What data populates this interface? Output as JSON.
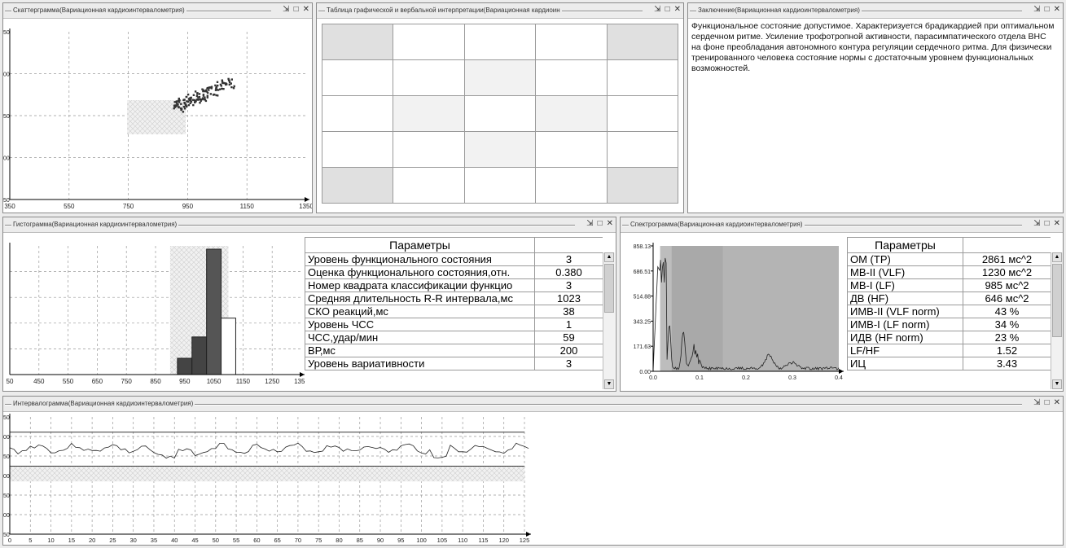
{
  "panels": {
    "scatter": {
      "title": "Скаттерграмма(Вариационная кардиоинтервалометрия)"
    },
    "interp": {
      "title": "Таблица графической и вербальной интерпретации(Вариационная кардиоин"
    },
    "conclusion": {
      "title": "Заключение(Вариационная кардиоинтервалометрия)",
      "text": "Функциональное состояние допустимое. Характеризуется брадикардией при оптимальном сердечном ритме. Усиление трофотропной активности, парасимпатического отдела ВНС на фоне преобладания автономного контура регуляции сердечного ритма. Для физически тренированного человека состояние нормы с достаточным уровнем функциональных возможностей."
    },
    "histogram": {
      "title": "Гистограмма(Вариационная кардиоинтервалометрия)"
    },
    "spectrum": {
      "title": "Спектрограмма(Вариационная кардиоинтервалометрия)"
    },
    "interval": {
      "title": "Интервалограмма(Вариационная кардиоинтервалометрия)"
    }
  },
  "window_buttons": {
    "pin": "⇲",
    "restore": "□",
    "close": "✕"
  },
  "hist_params": {
    "header": "Параметры",
    "rows": [
      {
        "label": "Уровень функционального состояния",
        "value": "3"
      },
      {
        "label": "Оценка функционального состояния,отн.",
        "value": "0.380"
      },
      {
        "label": " Номер квадрата классификации функцио",
        "value": "3"
      },
      {
        "label": "Средняя длительность R-R интервала,мс",
        "value": "1023"
      },
      {
        "label": "СКО реакций,мс",
        "value": "38"
      },
      {
        "label": "Уровень ЧСС",
        "value": "1"
      },
      {
        "label": "ЧСС,удар/мин",
        "value": "59"
      },
      {
        "label": "ВР,мс",
        "value": "200"
      },
      {
        "label": "Уровень вариативности",
        "value": "3"
      }
    ]
  },
  "spec_params": {
    "header": "Параметры",
    "rows": [
      {
        "label": "ОМ (ТР)",
        "value": "2861 мс^2"
      },
      {
        "label": "МВ-II (VLF)",
        "value": "1230 мс^2"
      },
      {
        "label": "МВ-I (LF)",
        "value": "985 мс^2"
      },
      {
        "label": "ДВ (HF)",
        "value": "646 мс^2"
      },
      {
        "label": "ИМВ-II (VLF norm)",
        "value": "43 %"
      },
      {
        "label": "ИМВ-I (LF norm)",
        "value": "34 %"
      },
      {
        "label": "ИДВ (HF norm)",
        "value": "23 %"
      },
      {
        "label": "LF/HF",
        "value": "1.52"
      },
      {
        "label": "ИЦ",
        "value": "3.43"
      }
    ]
  },
  "chart_data": [
    {
      "type": "scatter",
      "x_ticks": [
        "350",
        "550",
        "750",
        "950",
        "1150",
        "1350"
      ],
      "y_ticks": [
        "50",
        "00",
        "50",
        "00",
        "50"
      ],
      "xlim": [
        350,
        1350
      ],
      "points_center": [
        1020,
        1020
      ]
    },
    {
      "type": "bar",
      "x_ticks": [
        "50",
        "450",
        "550",
        "650",
        "750",
        "850",
        "950",
        "1050",
        "1150",
        "1250",
        "1350"
      ],
      "bins": [
        {
          "x": 950,
          "value": 0.13
        },
        {
          "x": 1000,
          "value": 0.3
        },
        {
          "x": 1050,
          "value": 1.0
        },
        {
          "x": 1100,
          "value": 0.45
        }
      ]
    },
    {
      "type": "line",
      "x_ticks": [
        "0.0",
        "0.1",
        "0.2",
        "0.3",
        "0.4"
      ],
      "y_ticks": [
        "858.13",
        "686.51",
        "514.88",
        "343.25",
        "171.63",
        "0.00"
      ],
      "xlim": [
        0,
        0.4
      ],
      "ylim": [
        0,
        858.13
      ]
    },
    {
      "type": "line",
      "x_ticks": [
        "0",
        "5",
        "10",
        "15",
        "20",
        "25",
        "30",
        "35",
        "40",
        "45",
        "50",
        "55",
        "60",
        "65",
        "70",
        "75",
        "80",
        "85",
        "90",
        "95",
        "100",
        "105",
        "110",
        "115",
        "120",
        "125"
      ],
      "y_ticks": [
        "50",
        "00",
        "50",
        "00",
        "50",
        "00",
        "50"
      ],
      "xlim": [
        0,
        125
      ]
    }
  ]
}
